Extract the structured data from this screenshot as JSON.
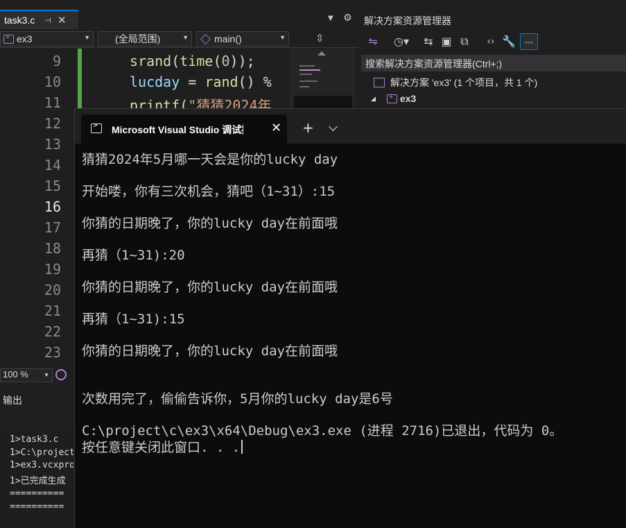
{
  "editor": {
    "tab": {
      "filename": "task3.c",
      "pin": "⊣",
      "close": "✕"
    },
    "tab_overflow": "▼",
    "tab_gear": "⚙",
    "nav": {
      "project": "ex3",
      "scope": "(全局范围)",
      "function": "main()"
    },
    "line_numbers": [
      "9",
      "10",
      "11",
      "12",
      "13",
      "14",
      "15",
      "16",
      "17",
      "18",
      "19",
      "20",
      "21",
      "22",
      "23"
    ],
    "active_line": "16",
    "code": {
      "l9": {
        "fn": "srand",
        "p1": "(",
        "fn2": "time",
        "p2": "(",
        "num": "0",
        "p3": "));"
      },
      "l10": {
        "var": "lucday",
        "op": " = ",
        "fn": "rand",
        "rest": "() %"
      },
      "l11": {
        "fn": "printf",
        "p": "(",
        "str": "\"猜猜2024年"
      }
    },
    "zoom": "100 %"
  },
  "output": {
    "title": "输出",
    "lines": [
      "1>task3.c",
      "1>C:\\project",
      "1>ex3.vcxpro",
      "1>已完成生成",
      "==========  生",
      "==========  生"
    ]
  },
  "solution_explorer": {
    "title": "解决方案资源管理器",
    "search_placeholder": "搜索解决方案资源管理器(Ctrl+;)",
    "solution_label": "解决方案 'ex3' (1 个项目，共 1 个)",
    "project_label": "ex3",
    "toolbar_icons": [
      "vs-switch-icon",
      "history-icon",
      "sync-icon",
      "collapse-icon",
      "copy-icon",
      "code-icon",
      "wrench-icon",
      "preview-icon"
    ]
  },
  "console": {
    "tab_title": "Microsoft Visual Studio 调试控制台",
    "close": "✕",
    "new_tab": "+",
    "lines": [
      "猜猜2024年5月哪一天会是你的lucky day",
      "开始喽，你有三次机会，猜吧（1~31）:15",
      "你猜的日期晚了，你的lucky day在前面哦",
      "再猜（1~31):20",
      "你猜的日期晚了，你的lucky day在前面哦",
      "再猜（1~31):15",
      "你猜的日期晚了，你的lucky day在前面哦",
      "次数用完了，偷偷告诉你，5月你的lucky day是6号",
      "C:\\project\\c\\ex3\\x64\\Debug\\ex3.exe (进程 2716)已退出，代码为 0。",
      "按任意键关闭此窗口. . ."
    ]
  }
}
